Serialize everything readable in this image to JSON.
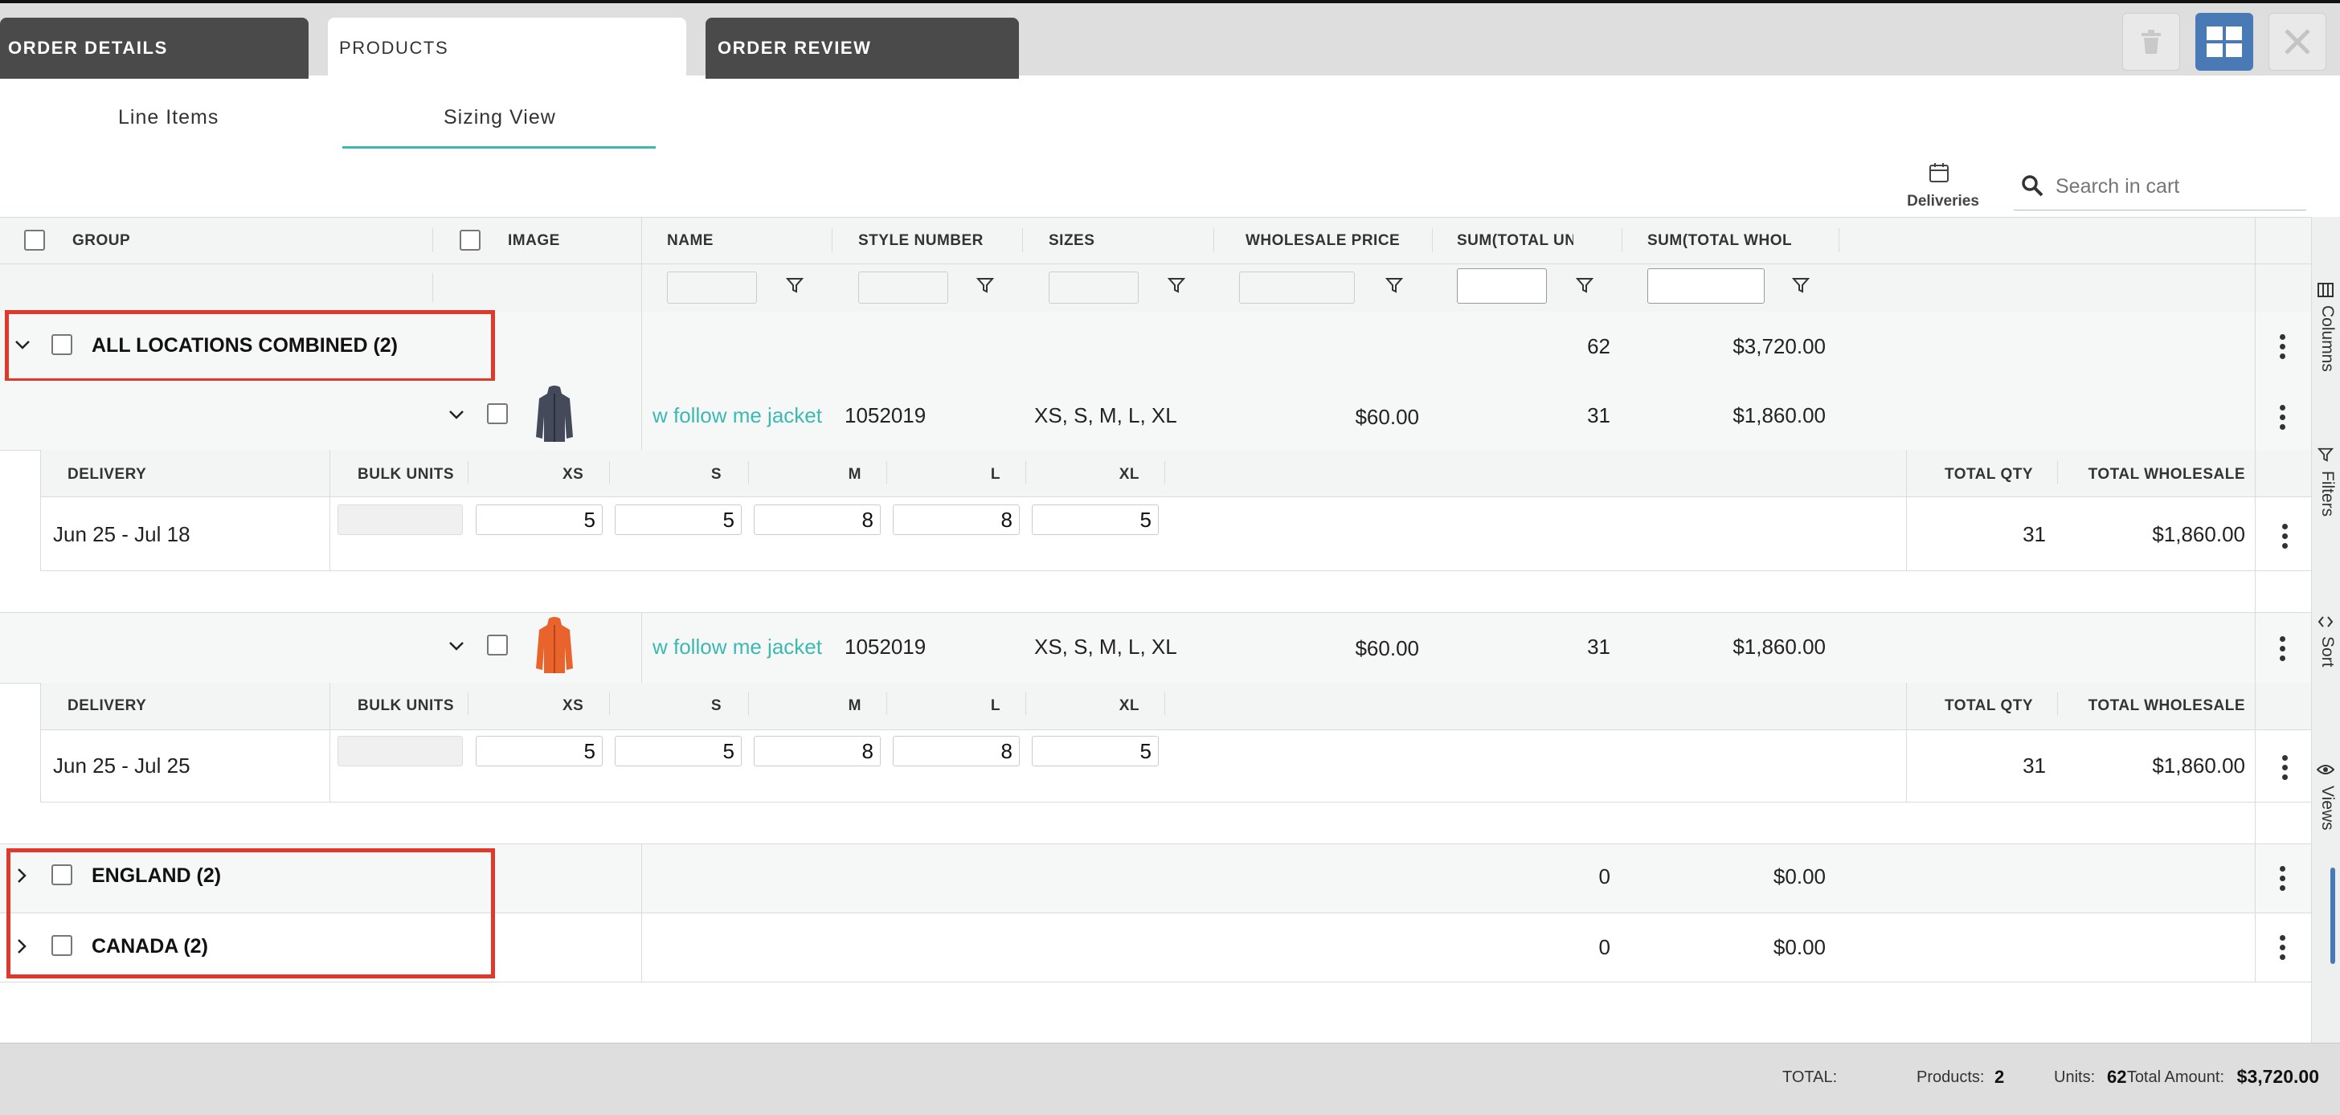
{
  "tabs": {
    "order_details": "ORDER DETAILS",
    "products": "PRODUCTS",
    "order_review": "ORDER REVIEW"
  },
  "subtabs": {
    "line_items": "Line Items",
    "sizing_view": "Sizing View"
  },
  "toolbar": {
    "deliveries_label": "Deliveries",
    "search_placeholder": "Search in cart"
  },
  "columns": {
    "group": "GROUP",
    "image": "IMAGE",
    "name": "NAME",
    "style_number": "STYLE NUMBER",
    "sizes": "SIZES",
    "wholesale_price": "WHOLESALE PRICE",
    "sum_total_units": "SUM(TOTAL UNI",
    "sum_total_wholesale": "SUM(TOTAL WHOLE"
  },
  "groups": [
    {
      "label": "ALL LOCATIONS COMBINED (2)",
      "units": "62",
      "wholesale": "$3,720.00"
    },
    {
      "label": "ENGLAND (2)",
      "units": "0",
      "wholesale": "$0.00"
    },
    {
      "label": "CANADA (2)",
      "units": "0",
      "wholesale": "$0.00"
    }
  ],
  "products": [
    {
      "name": "w follow me jacket",
      "style": "1052019",
      "sizes": "XS, S, M, L, XL",
      "price": "$60.00",
      "units": "31",
      "wholesale": "$1,860.00",
      "jacket_color": "#454a5a"
    },
    {
      "name": "w follow me jacket",
      "style": "1052019",
      "sizes": "XS, S, M, L, XL",
      "price": "$60.00",
      "units": "31",
      "wholesale": "$1,860.00",
      "jacket_color": "#e8642c"
    }
  ],
  "sizing_headers": {
    "delivery": "DELIVERY",
    "bulk_units": "BULK UNITS",
    "xs": "XS",
    "s": "S",
    "m": "M",
    "l": "L",
    "xl": "XL",
    "total_qty": "TOTAL QTY",
    "total_wholesale": "TOTAL WHOLESALE"
  },
  "sizing_rows": [
    {
      "delivery": "Jun 25 - Jul 18",
      "xs": "5",
      "s": "5",
      "m": "8",
      "l": "8",
      "xl": "5",
      "total_qty": "31",
      "total_wholesale": "$1,860.00"
    },
    {
      "delivery": "Jun 25 - Jul 25",
      "xs": "5",
      "s": "5",
      "m": "8",
      "l": "8",
      "xl": "5",
      "total_qty": "31",
      "total_wholesale": "$1,860.00"
    }
  ],
  "side_panel": {
    "columns": "Columns",
    "filters": "Filters",
    "sort": "Sort",
    "views": "Views"
  },
  "footer": {
    "total_label": "TOTAL:",
    "products_label": "Products:",
    "products_value": "2",
    "units_label": "Units:",
    "units_value": "62",
    "amount_label": "Total Amount:",
    "amount_value": "$3,720.00"
  },
  "colors": {
    "accent": "#3cb9b0",
    "highlight": "#e0392b",
    "active_button": "#4a7ab5"
  }
}
